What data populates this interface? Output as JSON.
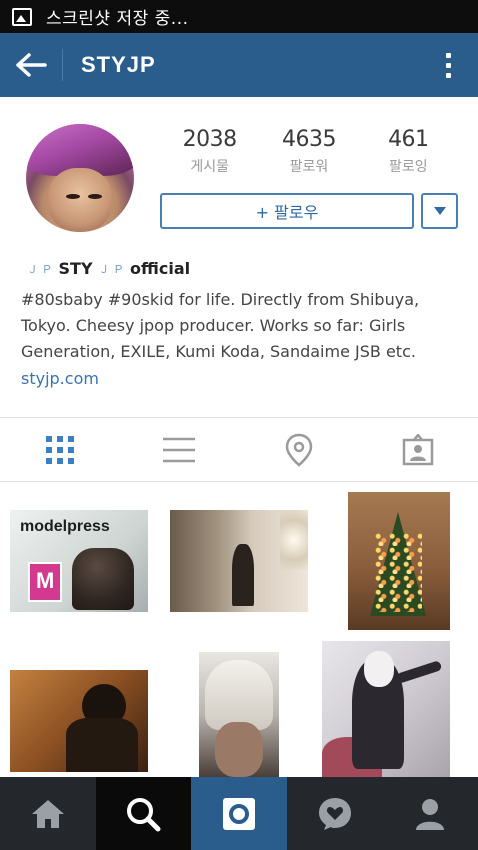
{
  "status_bar": {
    "text": "스크린샷 저장 중..."
  },
  "app_bar": {
    "title": "STYJP"
  },
  "profile": {
    "stats": [
      {
        "value": "2038",
        "label": "게시물"
      },
      {
        "value": "4635",
        "label": "팔로워"
      },
      {
        "value": "461",
        "label": "팔로잉"
      }
    ],
    "follow_label": "+ 팔로우",
    "name": {
      "glyph_left": "Ｊ Ｐ",
      "main": "STY",
      "glyph_right": "Ｊ Ｐ",
      "suffix": "official"
    },
    "bio": "#80sbaby #90skid for life. Directly from Shibuya, Tokyo. Cheesy jpop producer. Works so far: Girls Generation, EXILE, Kumi Koda, Sandaime JSB etc.",
    "website": "styjp.com"
  },
  "photo_1_text": "modelpress",
  "colors": {
    "app_bar": "#2a5d8c",
    "accent": "#2f6aa3",
    "bottom_nav": "#24282d",
    "tab_icon": "#3b7fc4"
  },
  "icons": {
    "tabs": [
      "grid-icon",
      "list-icon",
      "location-pin-icon",
      "tagged-user-icon"
    ],
    "bottom_nav": [
      "home-icon",
      "search-icon",
      "camera-icon",
      "activity-heart-icon",
      "profile-icon"
    ]
  }
}
